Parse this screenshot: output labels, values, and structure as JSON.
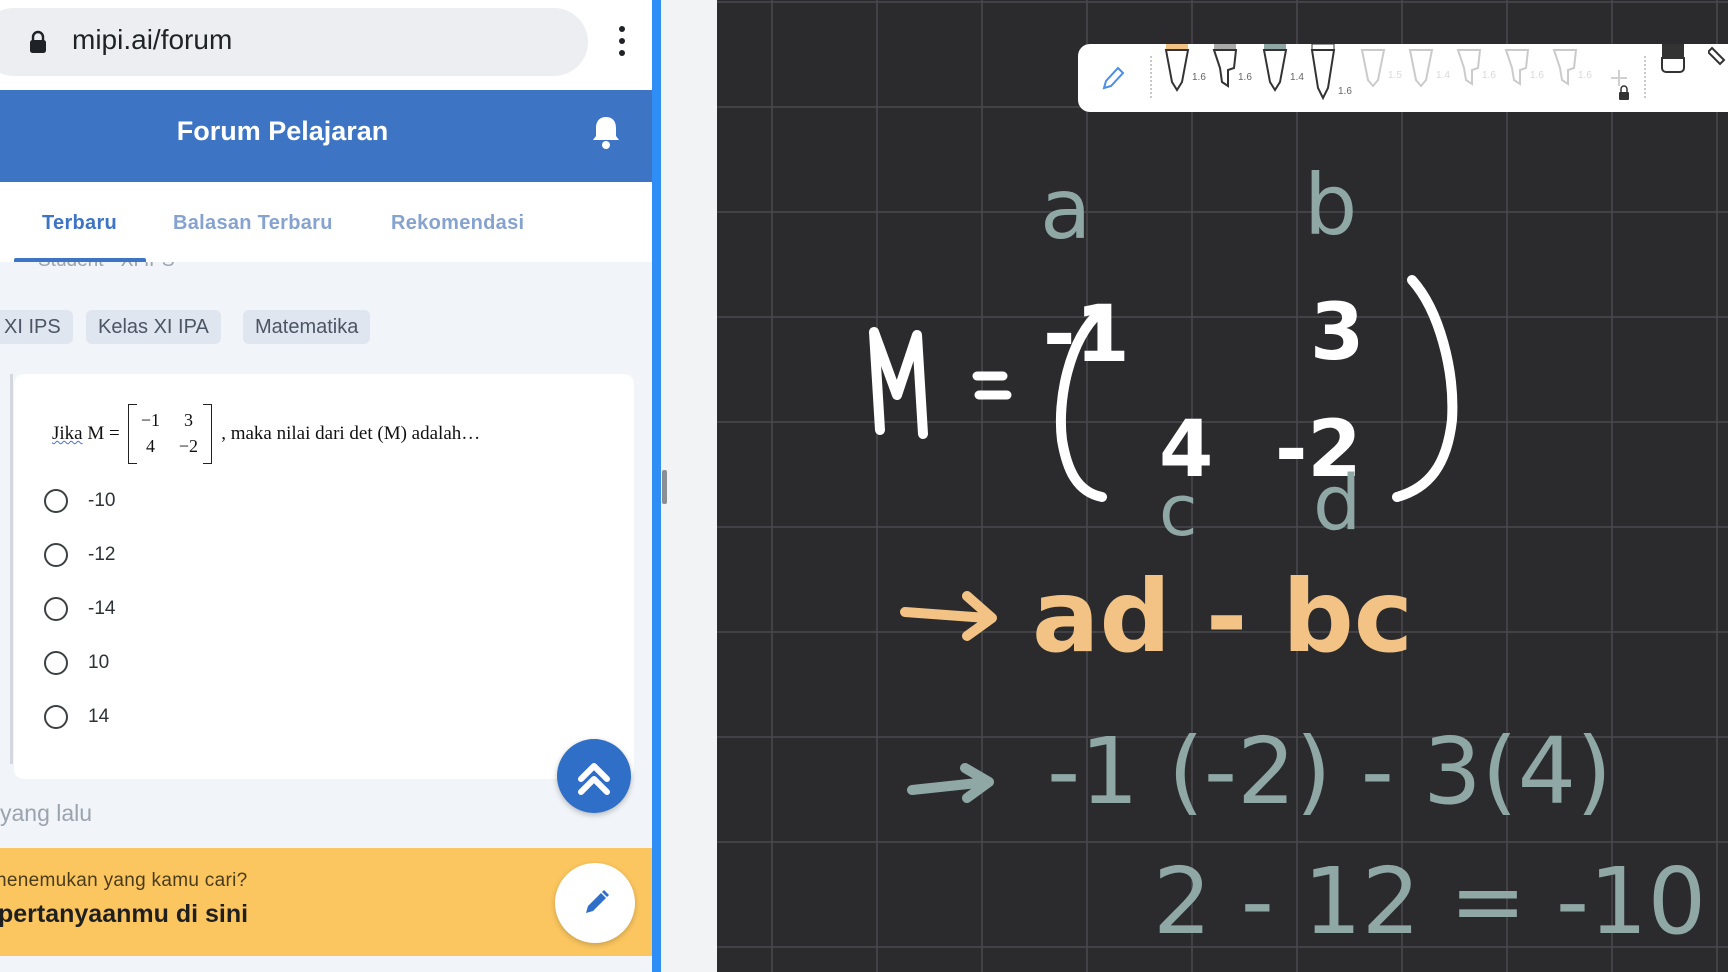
{
  "browser": {
    "url": "mipi.ai/forum"
  },
  "app": {
    "title": "Forum Pelajaran",
    "tabs": [
      {
        "label": "Terbaru",
        "active": true
      },
      {
        "label": "Balasan Terbaru",
        "active": false
      },
      {
        "label": "Rekomendasi",
        "active": false
      }
    ],
    "author_meta": "Student • XI IPS",
    "chips": [
      "XI IPS",
      "Kelas XI IPA",
      "Matematika"
    ],
    "question": {
      "prefix": "Jika",
      "matrix_name": "M =",
      "matrix": [
        [
          "−1",
          "3"
        ],
        [
          "4",
          "−2"
        ]
      ],
      "suffix": ", maka nilai dari det (M) adalah…"
    },
    "options": [
      "-10",
      "-12",
      "-14",
      "10",
      "14"
    ],
    "time_ago": "yang lalu",
    "banner": {
      "line1": "nenemukan yang kamu cari?",
      "line2": "pertanyaanmu di sini"
    },
    "icons": [
      "lock-icon",
      "more-vert-icon",
      "bell-icon",
      "double-chevron-up-icon",
      "pencil-icon"
    ]
  },
  "notes": {
    "toolbar": {
      "pen_sizes": [
        "1.6",
        "1.6",
        "1.4",
        "1.6",
        "1.5",
        "1.4",
        "1.6",
        "1.6",
        "1.6"
      ]
    },
    "handwriting": {
      "labels_ab": [
        "a",
        "b"
      ],
      "labels_cd": [
        "c",
        "d"
      ],
      "matrix_eq": "M =",
      "matrix": [
        [
          "-1",
          "3"
        ],
        [
          "4",
          "-2"
        ]
      ],
      "formula": "ad - bc",
      "step1": "-1 (-2) - 3(4)",
      "step2": "2 - 12 = -10"
    },
    "colors": {
      "board": "#2b2b2d",
      "grid": "#4b4b4e",
      "ink_white": "#ffffff",
      "ink_orange": "#f2c384",
      "ink_teal": "#8fa8a6"
    }
  }
}
